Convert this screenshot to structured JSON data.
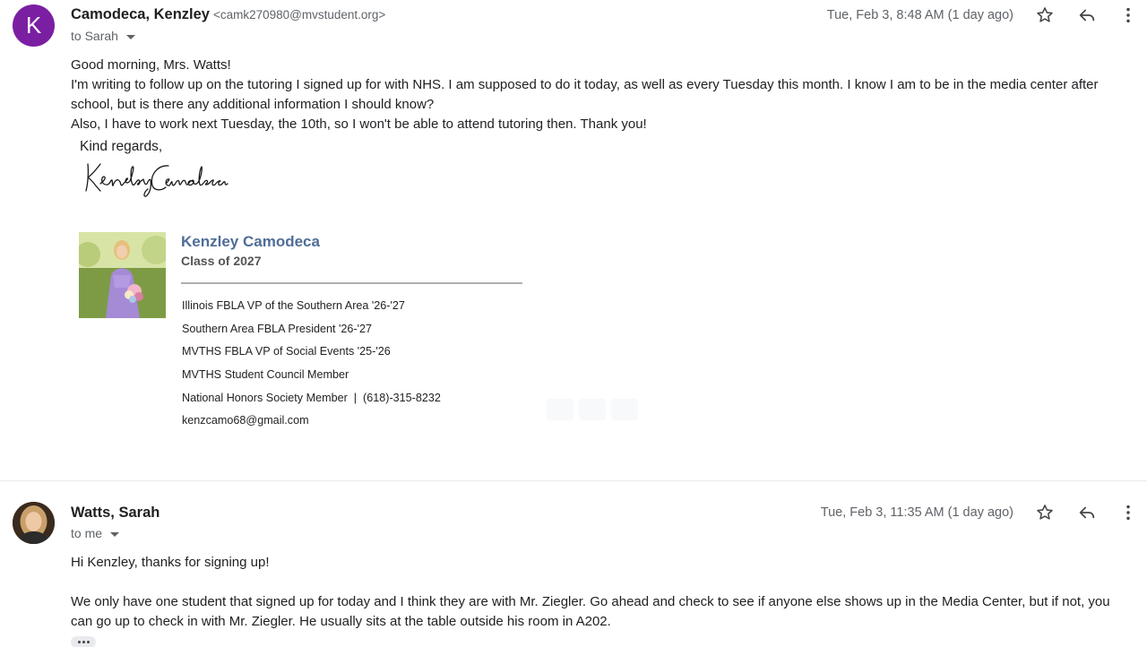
{
  "messages": [
    {
      "avatar_letter": "K",
      "avatar_color": "#7b1fa2",
      "sender_name": "Camodeca, Kenzley",
      "sender_email": "<camk270980@mvstudent.org>",
      "to_label": "to Sarah",
      "date": "Tue, Feb 3, 8:48 AM (1 day ago)",
      "body": [
        "Good morning, Mrs. Watts!",
        "I'm writing to follow up on the tutoring I signed up for with NHS. I am supposed to do it today, as well as every Tuesday this month. I know I am to be in the media center after school, but is there any additional information I should know?",
        "Also, I have to work next Tuesday, the 10th, so I won't be able to attend tutoring then. Thank you!"
      ],
      "closing": "Kind regards,",
      "handwritten_signature": "Kenzley Camodeca",
      "signature_block": {
        "name": "Kenzley Camodeca",
        "class": "Class of 2027",
        "name_color": "#4f6d98",
        "lines": [
          "Illinois FBLA VP of the Southern Area '26-'27",
          "Southern Area FBLA President '26-'27",
          "MVTHS FBLA VP of Social Events '25-'26",
          "MVTHS Student Council Member",
          "National Honors Society Member  |  (618)-315-8232",
          "kenzcamo68@gmail.com"
        ]
      }
    },
    {
      "sender_name": "Watts, Sarah",
      "to_label": "to me",
      "date": "Tue, Feb 3, 11:35 AM (1 day ago)",
      "body": [
        "Hi Kenzley, thanks for signing up!",
        "We only have one student that signed up for today and I think they are with Mr. Ziegler. Go ahead and check to see if anyone else shows up in the Media Center, but if not, you can go up to check in with Mr. Ziegler. He usually sits at the table outside his room in A202."
      ]
    }
  ],
  "icons": {
    "star": "star-icon",
    "reply": "reply-icon",
    "more": "more-vert-icon",
    "ellipsis": "show-trimmed-content-icon"
  }
}
